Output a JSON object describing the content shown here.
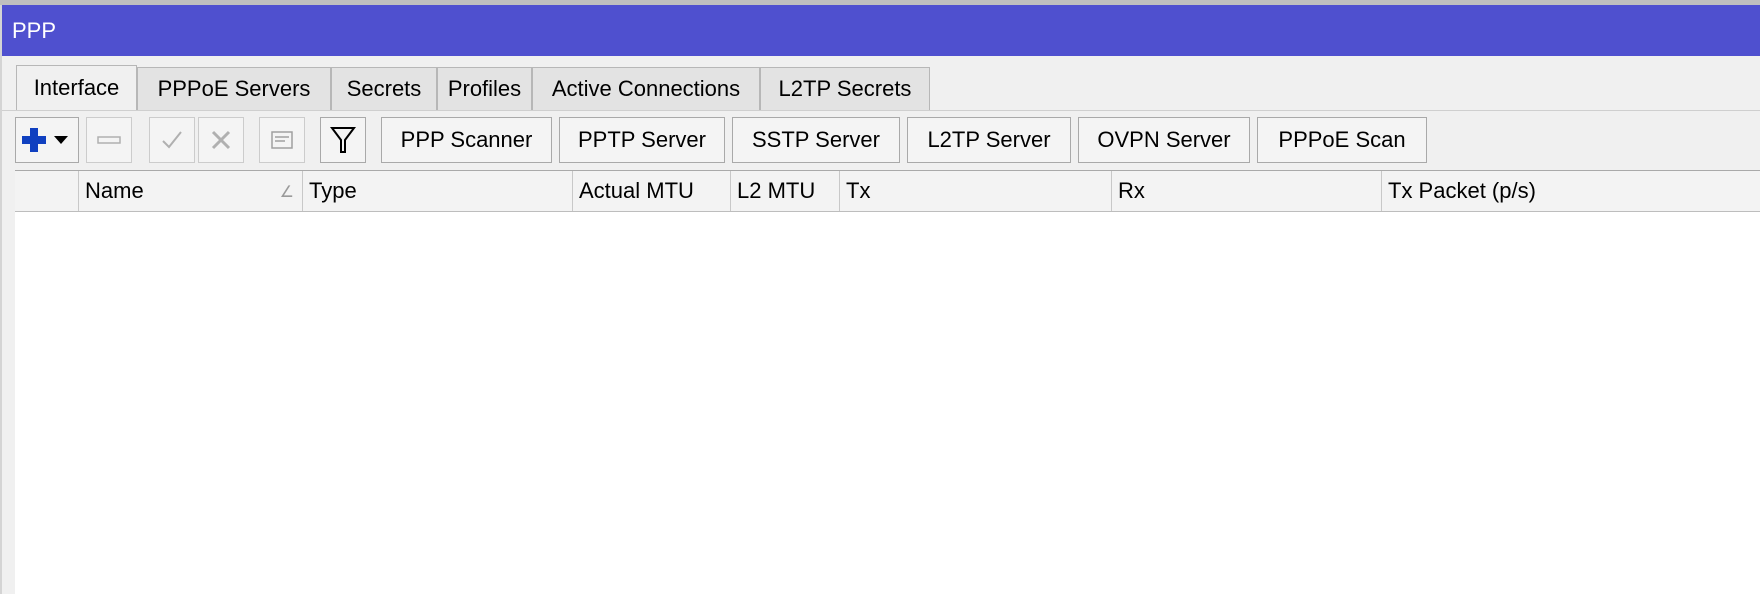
{
  "window": {
    "title": "PPP"
  },
  "tabs": [
    {
      "label": "Interface",
      "active": true
    },
    {
      "label": "PPPoE Servers"
    },
    {
      "label": "Secrets"
    },
    {
      "label": "Profiles"
    },
    {
      "label": "Active Connections"
    },
    {
      "label": "L2TP Secrets"
    }
  ],
  "toolbar": {
    "icons": [
      "add-icon",
      "remove-icon",
      "enable-icon",
      "disable-icon",
      "comment-icon",
      "filter-icon"
    ],
    "buttons": [
      "PPP Scanner",
      "PPTP Server",
      "SSTP Server",
      "L2TP Server",
      "OVPN Server",
      "PPPoE Scan"
    ]
  },
  "table": {
    "columns": [
      "",
      "Name",
      "Type",
      "Actual MTU",
      "L2 MTU",
      "Tx",
      "Rx",
      "Tx Packet (p/s)"
    ],
    "rows": []
  },
  "colors": {
    "titlebar": "#4f50cf",
    "add_icon": "#1040c0"
  }
}
